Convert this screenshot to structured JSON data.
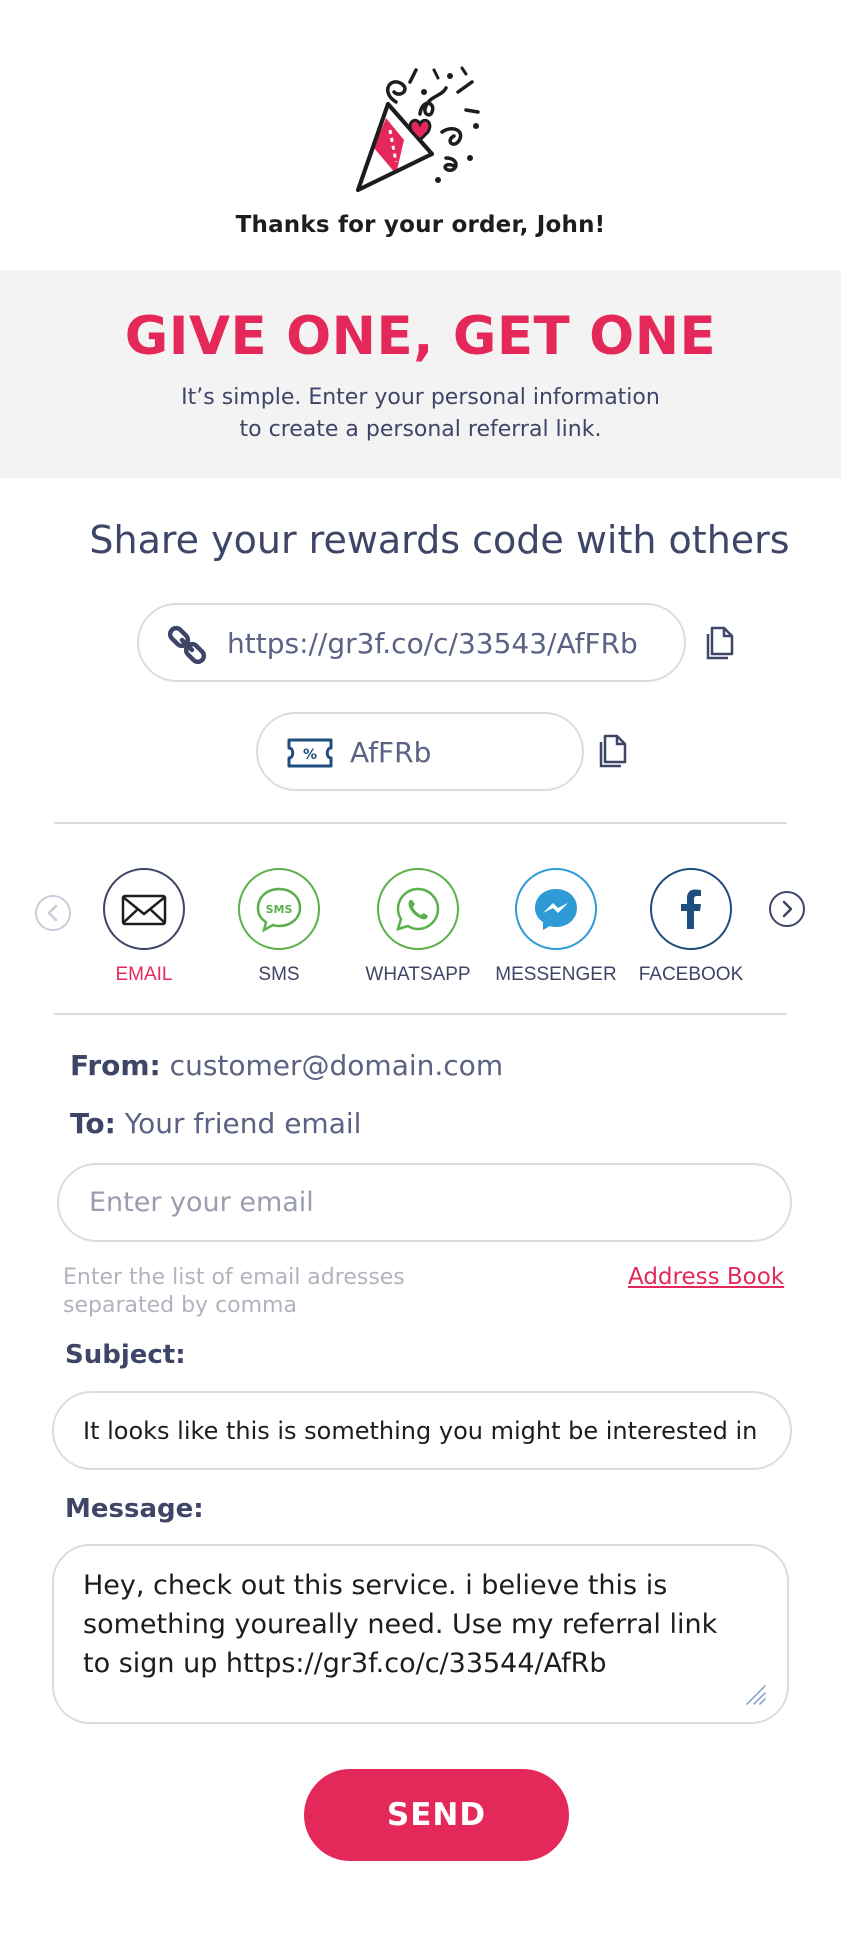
{
  "header": {
    "icon": "party-popper-icon",
    "thanks": "Thanks for your order, John!"
  },
  "banner": {
    "title": "GIVE ONE, GET ONE",
    "subtitle_line1": "It’s simple. Enter your personal information",
    "subtitle_line2": "to create a personal referral link."
  },
  "share": {
    "title": "Share your rewards code with others",
    "link": "https://gr3f.co/c/33543/AfFRb",
    "code": "AfFRb"
  },
  "channels": [
    {
      "label": "EMAIL",
      "icon": "envelope-icon",
      "active": true
    },
    {
      "label": "SMS",
      "icon": "sms-icon",
      "active": false
    },
    {
      "label": "WHATSAPP",
      "icon": "whatsapp-icon",
      "active": false
    },
    {
      "label": "MESSENGER",
      "icon": "messenger-icon",
      "active": false
    },
    {
      "label": "FACEBOOK",
      "icon": "facebook-icon",
      "active": false
    }
  ],
  "form": {
    "from_label": "From:",
    "from_value": "customer@domain.com",
    "to_label": "To:",
    "to_value": "Your friend email",
    "email_placeholder": "Enter your email",
    "hint": "Enter the list of email adresses separated by comma",
    "address_book": "Address Book",
    "subject_label": "Subject:",
    "subject_value": "It looks like this is something you might be interested in",
    "message_label": "Message:",
    "message_value": "Hey, check out this service. i believe this is something youreally need. Use my referral link to sign up https://gr3f.co/c/33544/AfRb",
    "send_label": "SEND"
  },
  "colors": {
    "accent": "#e5285a",
    "text": "#3e4566",
    "banner_bg": "#f3f3f4",
    "border": "#dcdcdf"
  }
}
